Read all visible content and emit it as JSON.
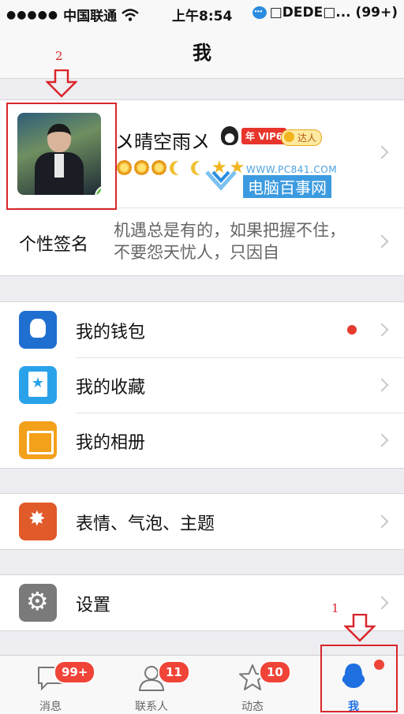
{
  "status_bar": {
    "signal": "●●●●●",
    "carrier": "中国联通",
    "time": "上午8:54",
    "notification": "□DEDE□... (99+)"
  },
  "nav": {
    "title": "我"
  },
  "profile": {
    "nickname": "〤晴空雨〤",
    "vip_label": "VIP6",
    "vip_prefix": "年",
    "daren_label": "达人",
    "level_icons": [
      "sun",
      "sun",
      "sun",
      "moon",
      "moon",
      "star",
      "star"
    ],
    "signature_label": "个性签名",
    "signature_text": "机遇总是有的，如果把握不住，不要怨天忧人，只因自",
    "watermark_url": "WWW.PC841.COM",
    "watermark_name": "电脑百事网"
  },
  "groups": [
    {
      "items": [
        {
          "label": "我的钱包",
          "icon": "wallet-icon",
          "has_dot": true
        },
        {
          "label": "我的收藏",
          "icon": "favorites-icon",
          "has_dot": false
        },
        {
          "label": "我的相册",
          "icon": "album-icon",
          "has_dot": false
        }
      ]
    },
    {
      "items": [
        {
          "label": "表情、气泡、主题",
          "icon": "emoji-theme-icon",
          "has_dot": false
        }
      ]
    },
    {
      "items": [
        {
          "label": "设置",
          "icon": "settings-icon",
          "has_dot": false
        }
      ]
    }
  ],
  "annotations": {
    "marker_1": "1",
    "marker_2": "2"
  },
  "tabs": [
    {
      "label": "消息",
      "badge": "99+",
      "icon": "messages-icon",
      "active": false
    },
    {
      "label": "联系人",
      "badge": "11",
      "icon": "contacts-icon",
      "active": false
    },
    {
      "label": "动态",
      "badge": "10",
      "icon": "feeds-icon",
      "active": false
    },
    {
      "label": "我",
      "badge": "",
      "icon": "me-icon",
      "active": true
    }
  ],
  "colors": {
    "accent": "#1e6fe0",
    "badge": "#f04438",
    "annotation_red": "#d9262a"
  }
}
